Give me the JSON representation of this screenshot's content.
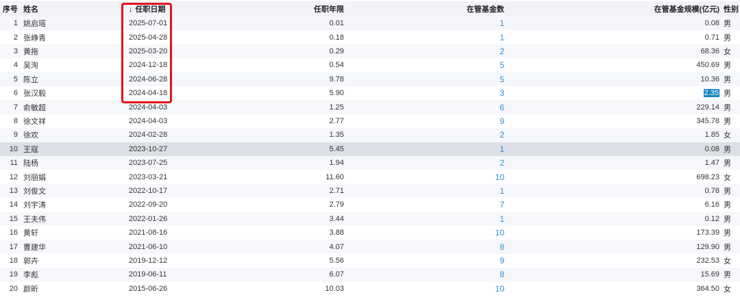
{
  "headers": {
    "idx": "序号",
    "name": "姓名",
    "sort_arrow": "↓",
    "date": "任职日期",
    "years": "任职年限",
    "count": "在管基金数",
    "scale": "在管基金规模(亿元)",
    "sex": "性别"
  },
  "rows": [
    {
      "idx": "1",
      "name": "姚启瑶",
      "date": "2025-07-01",
      "years": "0.01",
      "count": "1",
      "scale": "0.08",
      "sex": "男"
    },
    {
      "idx": "2",
      "name": "张峥青",
      "date": "2025-04-28",
      "years": "0.18",
      "count": "1",
      "scale": "0.71",
      "sex": "男"
    },
    {
      "idx": "3",
      "name": "黄拖",
      "date": "2025-03-20",
      "years": "0.29",
      "count": "2",
      "scale": "68.36",
      "sex": "女"
    },
    {
      "idx": "4",
      "name": "吴洵",
      "date": "2024-12-18",
      "years": "0.54",
      "count": "5",
      "scale": "450.69",
      "sex": "男"
    },
    {
      "idx": "5",
      "name": "陈立",
      "date": "2024-06-28",
      "years": "9.78",
      "count": "5",
      "scale": "10.36",
      "sex": "男"
    },
    {
      "idx": "6",
      "name": "张汉毅",
      "date": "2024-04-18",
      "years": "5.90",
      "count": "3",
      "scale": "2.35",
      "sex": "男",
      "scale_selected": true
    },
    {
      "idx": "7",
      "name": "俞敏超",
      "date": "2024-04-03",
      "years": "1.25",
      "count": "6",
      "scale": "229.14",
      "sex": "男"
    },
    {
      "idx": "8",
      "name": "徐文祥",
      "date": "2024-04-03",
      "years": "2.77",
      "count": "9",
      "scale": "345.78",
      "sex": "男"
    },
    {
      "idx": "9",
      "name": "徐欢",
      "date": "2024-02-28",
      "years": "1.35",
      "count": "2",
      "scale": "1.85",
      "sex": "女"
    },
    {
      "idx": "10",
      "name": "王寇",
      "date": "2023-10-27",
      "years": "5.45",
      "count": "1",
      "scale": "0.08",
      "sex": "男",
      "highlight": true
    },
    {
      "idx": "11",
      "name": "陆杨",
      "date": "2023-07-25",
      "years": "1.94",
      "count": "2",
      "scale": "1.47",
      "sex": "男"
    },
    {
      "idx": "12",
      "name": "刘丽娟",
      "date": "2023-03-21",
      "years": "11.60",
      "count": "10",
      "scale": "698.23",
      "sex": "女"
    },
    {
      "idx": "13",
      "name": "刘俊文",
      "date": "2022-10-17",
      "years": "2.71",
      "count": "1",
      "scale": "0.78",
      "sex": "男"
    },
    {
      "idx": "14",
      "name": "刘宇涛",
      "date": "2022-09-20",
      "years": "2.79",
      "count": "7",
      "scale": "6.16",
      "sex": "男"
    },
    {
      "idx": "15",
      "name": "王夫伟",
      "date": "2022-01-26",
      "years": "3.44",
      "count": "1",
      "scale": "0.12",
      "sex": "男"
    },
    {
      "idx": "16",
      "name": "黄轩",
      "date": "2021-08-16",
      "years": "3.88",
      "count": "10",
      "scale": "173.39",
      "sex": "男"
    },
    {
      "idx": "17",
      "name": "曹建华",
      "date": "2021-06-10",
      "years": "4.07",
      "count": "8",
      "scale": "129.90",
      "sex": "男"
    },
    {
      "idx": "18",
      "name": "郭卉",
      "date": "2019-12-12",
      "years": "5.56",
      "count": "9",
      "scale": "232.53",
      "sex": "女"
    },
    {
      "idx": "19",
      "name": "李彪",
      "date": "2019-06-11",
      "years": "6.07",
      "count": "8",
      "scale": "15.69",
      "sex": "男"
    },
    {
      "idx": "20",
      "name": "颜昕",
      "date": "2015-06-26",
      "years": "10.03",
      "count": "10",
      "scale": "364.50",
      "sex": "女"
    }
  ],
  "colors": {
    "link": "#2e8ec9",
    "annotation": "#e1121b",
    "selection": "#1a86c8"
  }
}
